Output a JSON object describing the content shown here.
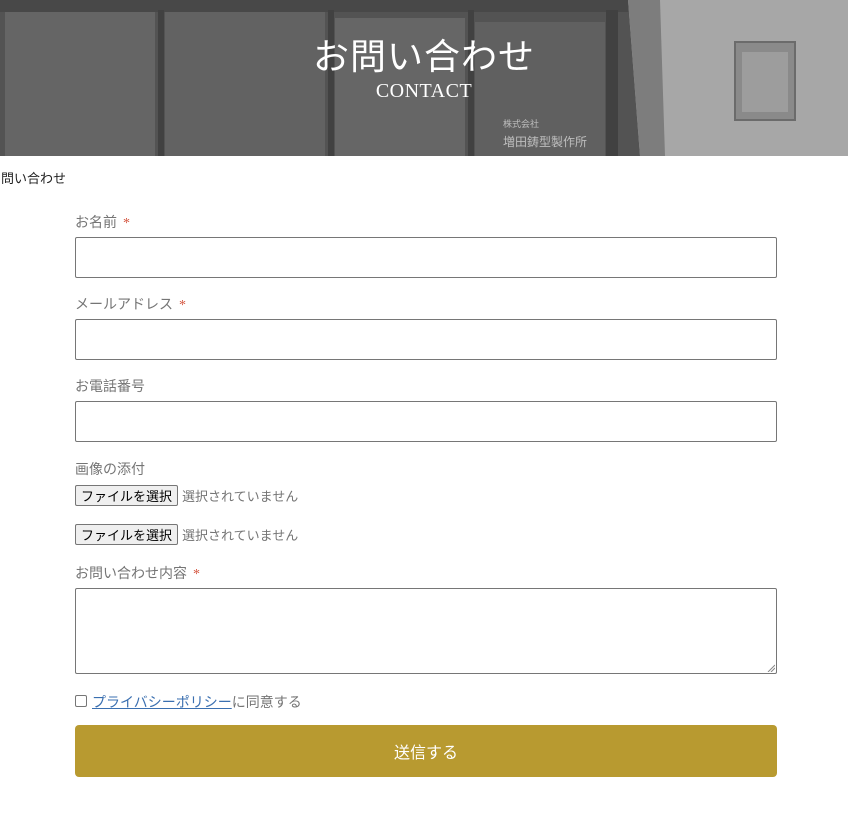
{
  "header": {
    "title": "お問い合わせ",
    "subtitle": "CONTACT",
    "sign_line1": "株式会社",
    "sign_line2": "増田鋳型製作所"
  },
  "breadcrumb": "問い合わせ",
  "form": {
    "name_label": "お名前",
    "email_label": "メールアドレス",
    "phone_label": "お電話番号",
    "image_label": "画像の添付",
    "file_button": "ファイルを選択",
    "file_status": "選択されていません",
    "message_label": "お問い合わせ内容",
    "required_mark": "*",
    "privacy_link": "プライバシーポリシー",
    "privacy_suffix": "に同意する",
    "submit_label": "送信する"
  },
  "colors": {
    "submit_bg": "#b89a30",
    "required": "#d5553f",
    "link": "#3a6fb0"
  }
}
